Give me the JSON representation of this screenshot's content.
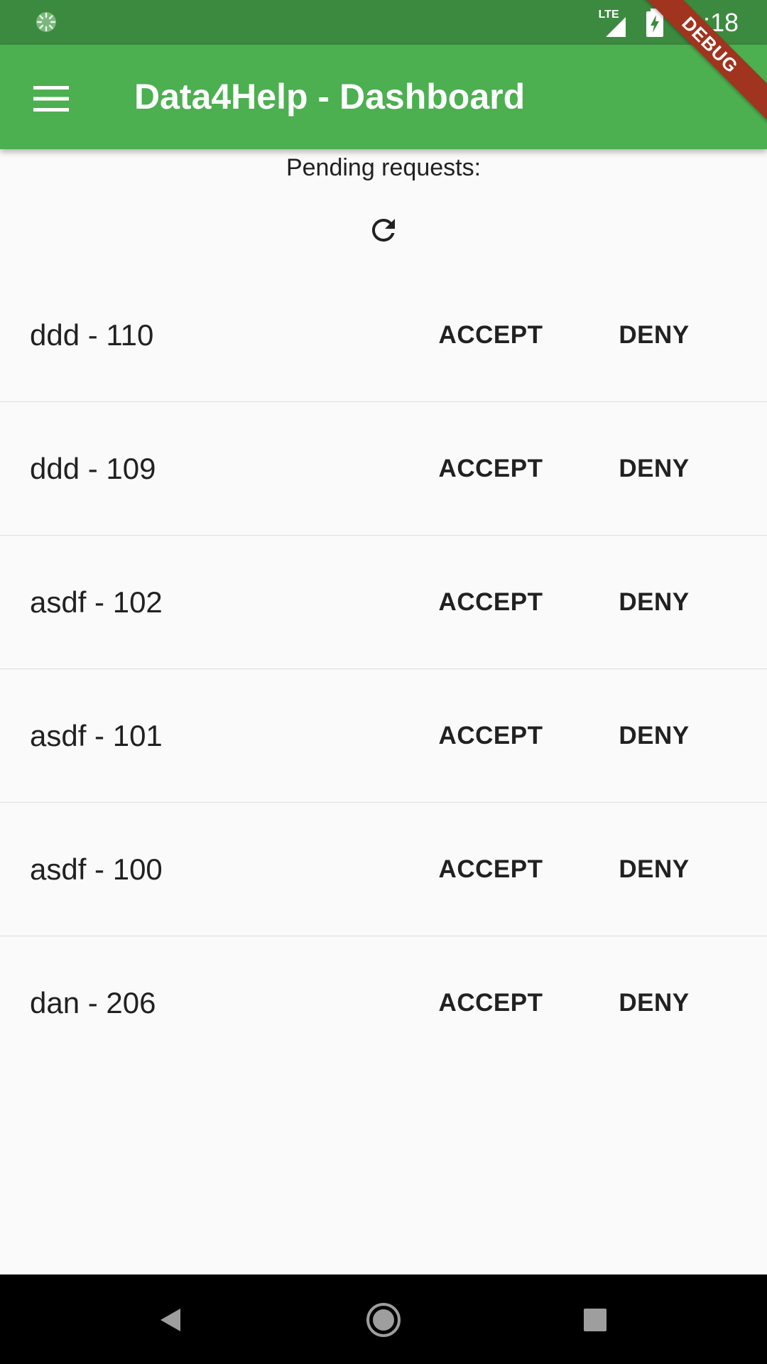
{
  "status_bar": {
    "network_label": "LTE",
    "time": "11:18",
    "icons": [
      "loading-spinner-icon",
      "signal-icon",
      "battery-charging-icon"
    ]
  },
  "app_bar": {
    "title": "Data4Help - Dashboard",
    "menu_icon": "menu-icon",
    "background_color": "#4caf50",
    "status_bar_color": "#3c8a3f"
  },
  "debug_banner": {
    "label": "DEBUG",
    "color": "#a0341f"
  },
  "main": {
    "heading": "Pending requests:",
    "refresh_icon": "refresh-icon",
    "requests": [
      {
        "label": "ddd - 110",
        "accept_label": "ACCEPT",
        "deny_label": "DENY"
      },
      {
        "label": "ddd - 109",
        "accept_label": "ACCEPT",
        "deny_label": "DENY"
      },
      {
        "label": "asdf - 102",
        "accept_label": "ACCEPT",
        "deny_label": "DENY"
      },
      {
        "label": "asdf - 101",
        "accept_label": "ACCEPT",
        "deny_label": "DENY"
      },
      {
        "label": "asdf - 100",
        "accept_label": "ACCEPT",
        "deny_label": "DENY"
      },
      {
        "label": "dan - 206",
        "accept_label": "ACCEPT",
        "deny_label": "DENY"
      }
    ]
  },
  "nav_bar": {
    "icons": [
      "back-icon",
      "home-icon",
      "recents-icon"
    ]
  }
}
